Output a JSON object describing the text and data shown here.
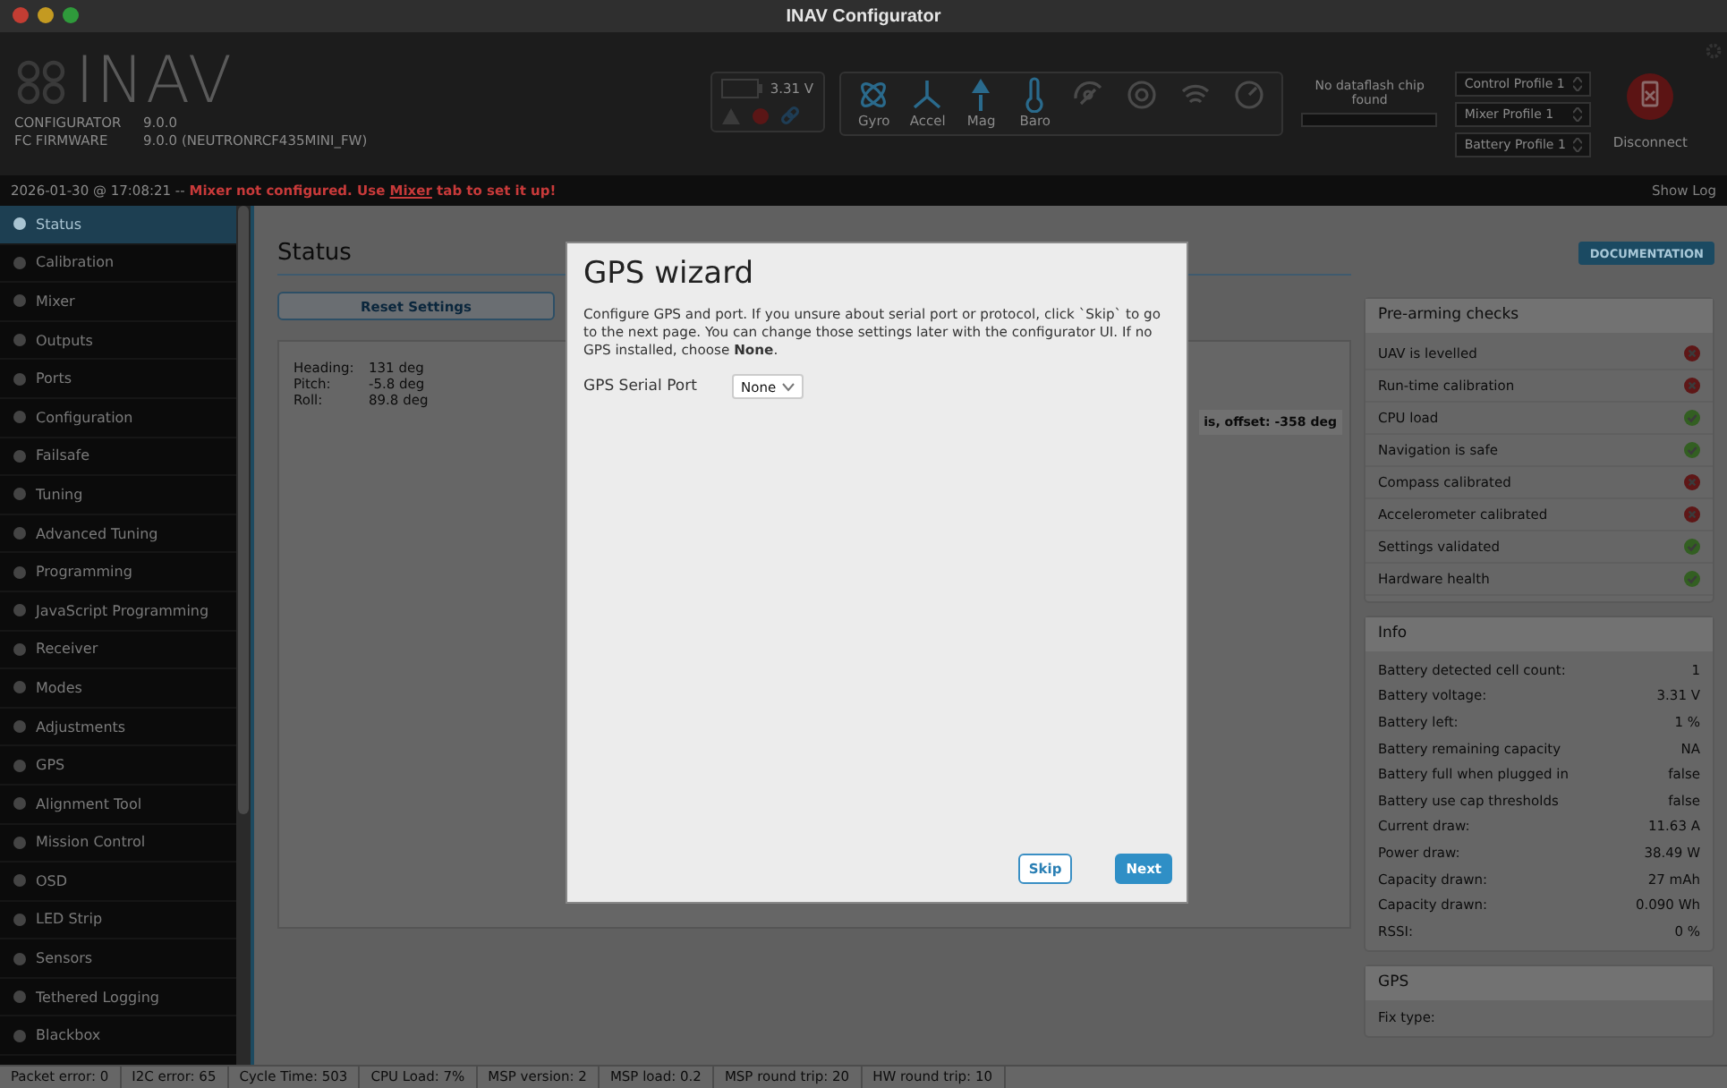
{
  "window": {
    "title": "INAV Configurator"
  },
  "header": {
    "logo": "INAV",
    "app_label": "CONFIGURATOR",
    "app_version": "9.0.0",
    "fw_label": "FC FIRMWARE",
    "fw_version": "9.0.0 (NEUTRONRCF435MINI_FW)",
    "battery_voltage": "3.31 V",
    "sensors": [
      {
        "kind": "gyro",
        "label": "Gyro",
        "active": true
      },
      {
        "kind": "accel",
        "label": "Accel",
        "active": true
      },
      {
        "kind": "mag",
        "label": "Mag",
        "active": true
      },
      {
        "kind": "baro",
        "label": "Baro",
        "active": true
      },
      {
        "kind": "gps",
        "active": false
      },
      {
        "kind": "flow",
        "active": false
      },
      {
        "kind": "sonar",
        "active": false
      },
      {
        "kind": "speed",
        "active": false
      }
    ],
    "dataflash": "No dataflash chip found",
    "profiles": [
      "Control Profile 1",
      "Mixer Profile 1",
      "Battery Profile 1"
    ],
    "disconnect": "Disconnect"
  },
  "log": {
    "timestamp": "2026-01-30 @ 17:08:21 --",
    "message_start": "Mixer not configured. Use",
    "link": "Mixer",
    "message_end": "tab to set it up!",
    "show_log": "Show Log"
  },
  "sidebar": {
    "items": [
      {
        "label": "Status",
        "selected": true
      },
      {
        "label": "Calibration",
        "selected": false
      },
      {
        "label": "Mixer",
        "selected": false
      },
      {
        "label": "Outputs",
        "selected": false
      },
      {
        "label": "Ports",
        "selected": false
      },
      {
        "label": "Configuration",
        "selected": false
      },
      {
        "label": "Failsafe",
        "selected": false
      },
      {
        "label": "Tuning",
        "selected": false
      },
      {
        "label": "Advanced Tuning",
        "selected": false
      },
      {
        "label": "Programming",
        "selected": false
      },
      {
        "label": "JavaScript Programming",
        "selected": false
      },
      {
        "label": "Receiver",
        "selected": false
      },
      {
        "label": "Modes",
        "selected": false
      },
      {
        "label": "Adjustments",
        "selected": false
      },
      {
        "label": "GPS",
        "selected": false
      },
      {
        "label": "Alignment Tool",
        "selected": false
      },
      {
        "label": "Mission Control",
        "selected": false
      },
      {
        "label": "OSD",
        "selected": false
      },
      {
        "label": "LED Strip",
        "selected": false
      },
      {
        "label": "Sensors",
        "selected": false
      },
      {
        "label": "Tethered Logging",
        "selected": false
      },
      {
        "label": "Blackbox",
        "selected": false
      }
    ]
  },
  "main": {
    "title": "Status",
    "documentation": "DOCUMENTATION",
    "reset": "Reset Settings",
    "attitude": [
      {
        "label": "Heading:",
        "value": "131 deg"
      },
      {
        "label": "Pitch:",
        "value": "-5.8 deg"
      },
      {
        "label": "Roll:",
        "value": "89.8 deg"
      }
    ],
    "offset": "is, offset: -358 deg"
  },
  "checks": {
    "title": "Pre-arming checks",
    "items": [
      {
        "label": "UAV is levelled",
        "ok": false
      },
      {
        "label": "Run-time calibration",
        "ok": false
      },
      {
        "label": "CPU load",
        "ok": true
      },
      {
        "label": "Navigation is safe",
        "ok": true
      },
      {
        "label": "Compass calibrated",
        "ok": false
      },
      {
        "label": "Accelerometer calibrated",
        "ok": false
      },
      {
        "label": "Settings validated",
        "ok": true
      },
      {
        "label": "Hardware health",
        "ok": true
      }
    ]
  },
  "info": {
    "title": "Info",
    "rows": [
      {
        "label": "Battery detected cell count:",
        "value": "1"
      },
      {
        "label": "Battery voltage:",
        "value": "3.31 V"
      },
      {
        "label": "Battery left:",
        "value": "1 %"
      },
      {
        "label": "Battery remaining capacity",
        "value": "NA"
      },
      {
        "label": "Battery full when plugged in",
        "value": "false"
      },
      {
        "label": "Battery use cap thresholds",
        "value": "false"
      },
      {
        "label": "Current draw:",
        "value": "11.63 A"
      },
      {
        "label": "Power draw:",
        "value": "38.49 W"
      },
      {
        "label": "Capacity drawn:",
        "value": "27 mAh"
      },
      {
        "label": "Capacity drawn:",
        "value": "0.090 Wh"
      },
      {
        "label": "RSSI:",
        "value": "0 %"
      }
    ]
  },
  "gps": {
    "title": "GPS",
    "rows": [
      {
        "label": "Fix type:"
      }
    ]
  },
  "status_bar": [
    "Packet error: 0",
    "I2C error: 65",
    "Cycle Time: 503",
    "CPU Load: 7%",
    "MSP version: 2",
    "MSP load: 0.2",
    "MSP round trip: 20",
    "HW round trip: 10"
  ],
  "dialog": {
    "title": "GPS wizard",
    "text": "Configure GPS and port. If you unsure about serial port or protocol, click `Skip` to go to the next page. You can change those settings later with the configurator UI. If no GPS installed, choose **None**.",
    "field_label": "GPS Serial Port",
    "field_value": "None",
    "buttons": [
      {
        "label": "Skip",
        "kind": "secondary"
      },
      {
        "label": "Next",
        "kind": "primary"
      }
    ]
  }
}
